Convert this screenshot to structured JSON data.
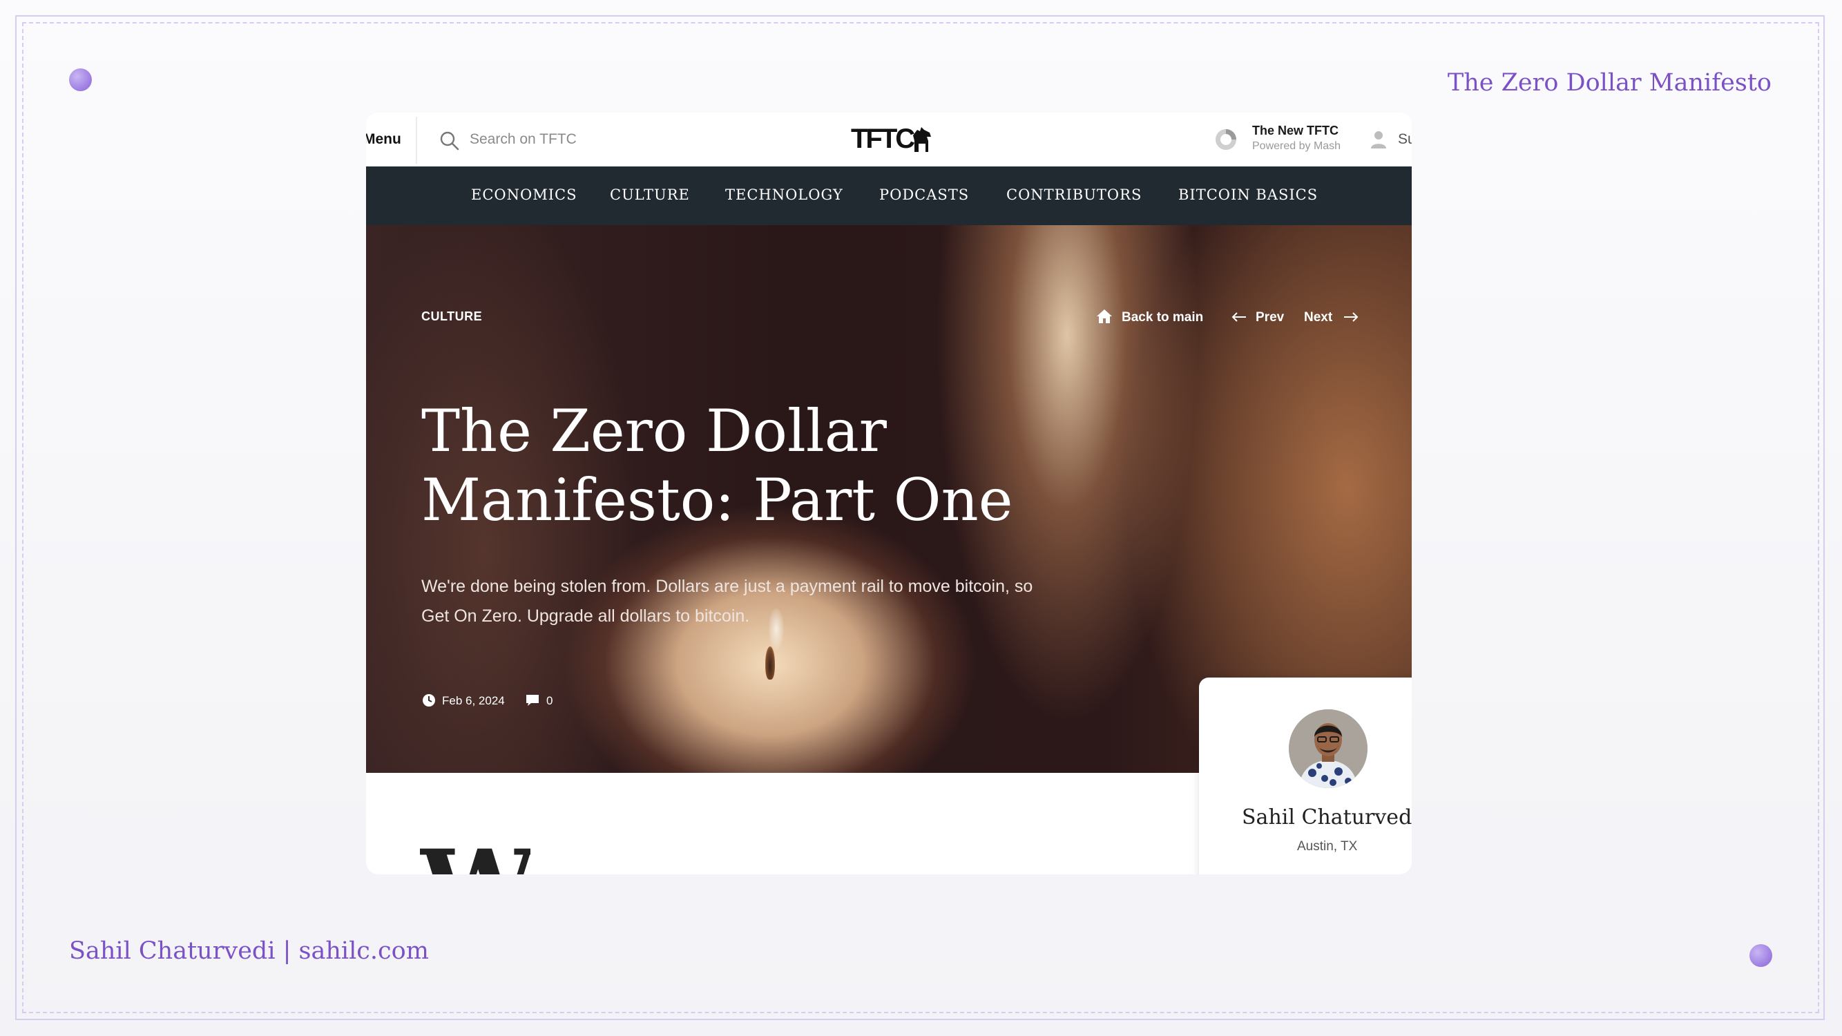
{
  "slide": {
    "title": "The Zero Dollar Manifesto",
    "credit": "Sahil Chaturvedi | sahilc.com"
  },
  "topbar": {
    "menu_label": "Menu",
    "search_placeholder": "Search on TFTC",
    "logo_text": "TFTC",
    "promo_title": "The New TFTC",
    "promo_subtitle": "Powered by Mash",
    "user_label": "Su"
  },
  "nav": {
    "items": [
      {
        "label": "ECONOMICS"
      },
      {
        "label": "CULTURE"
      },
      {
        "label": "TECHNOLOGY"
      },
      {
        "label": "PODCASTS"
      },
      {
        "label": "CONTRIBUTORS"
      },
      {
        "label": "BITCOIN BASICS"
      }
    ]
  },
  "article": {
    "category": "CULTURE",
    "back_label": "Back to main",
    "prev_label": "Prev",
    "next_label": "Next",
    "title_line1": "The Zero Dollar",
    "title_line2": "Manifesto: Part One",
    "deck_line1": "We're done being stolen from. Dollars are just a payment rail to move bitcoin, so",
    "deck_line2": "Get On Zero. Upgrade all dollars to bitcoin.",
    "date": "Feb 6, 2024",
    "comment_count": "0",
    "dropcap": "W"
  },
  "author": {
    "name": "Sahil Chaturvedi",
    "location": "Austin, TX"
  },
  "colors": {
    "accent": "#7a52c6",
    "nav_bg": "#222a31",
    "frame": "#d9cdef"
  }
}
